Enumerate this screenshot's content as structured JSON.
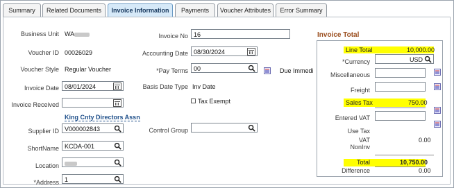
{
  "tabs": [
    "Summary",
    "Related Documents",
    "Invoice Information",
    "Payments",
    "Voucher Attributes",
    "Error Summary"
  ],
  "active_tab": "Invoice Information",
  "left": {
    "business_unit": {
      "label": "Business Unit",
      "value": "WA"
    },
    "voucher_id": {
      "label": "Voucher ID",
      "value": "00026029"
    },
    "voucher_style": {
      "label": "Voucher Style",
      "value": "Regular Voucher"
    },
    "invoice_date": {
      "label": "Invoice Date",
      "value": "08/01/2024"
    },
    "invoice_received": {
      "label": "Invoice Received",
      "value": ""
    },
    "supplier_name_link": "King Cnty Directors Assn",
    "supplier_id": {
      "label": "Supplier ID",
      "value": "V000002843"
    },
    "short_name": {
      "label": "ShortName",
      "value": "KCDA-001"
    },
    "location": {
      "label": "Location",
      "value": ""
    },
    "address": {
      "label": "*Address",
      "value": "1"
    }
  },
  "middle": {
    "invoice_no": {
      "label": "Invoice No",
      "value": "16"
    },
    "accounting_date": {
      "label": "Accounting Date",
      "value": "08/30/2024"
    },
    "pay_terms": {
      "label": "*Pay Terms",
      "value": "00",
      "extra": "Due Immedi"
    },
    "basis_date_type": {
      "label": "Basis Date Type",
      "value": "Inv Date"
    },
    "tax_exempt": "Tax Exempt",
    "control_group": {
      "label": "Control Group",
      "value": ""
    }
  },
  "invoice_total": {
    "title": "Invoice Total",
    "line_total": {
      "label": "Line Total",
      "value": "10,000.00"
    },
    "currency": {
      "label": "*Currency",
      "value": "USD"
    },
    "miscellaneous": {
      "label": "Miscellaneous",
      "value": ""
    },
    "freight": {
      "label": "Freight",
      "value": ""
    },
    "sales_tax": {
      "label": "Sales Tax",
      "value": "750.00"
    },
    "entered_vat": {
      "label": "Entered VAT",
      "value": ""
    },
    "use_tax": {
      "label": "Use Tax"
    },
    "vat_noninv": {
      "label1": "VAT",
      "label2": "NonInv",
      "value": "0.00"
    },
    "total": {
      "label": "Total",
      "value": "10,750.00"
    },
    "difference": {
      "label": "Difference",
      "value": "0.00"
    }
  },
  "colors": {
    "highlight": "#ffff00",
    "tab_active": "#d6e9f8",
    "section_title": "#9a4d1d",
    "link": "#1d4e89"
  }
}
